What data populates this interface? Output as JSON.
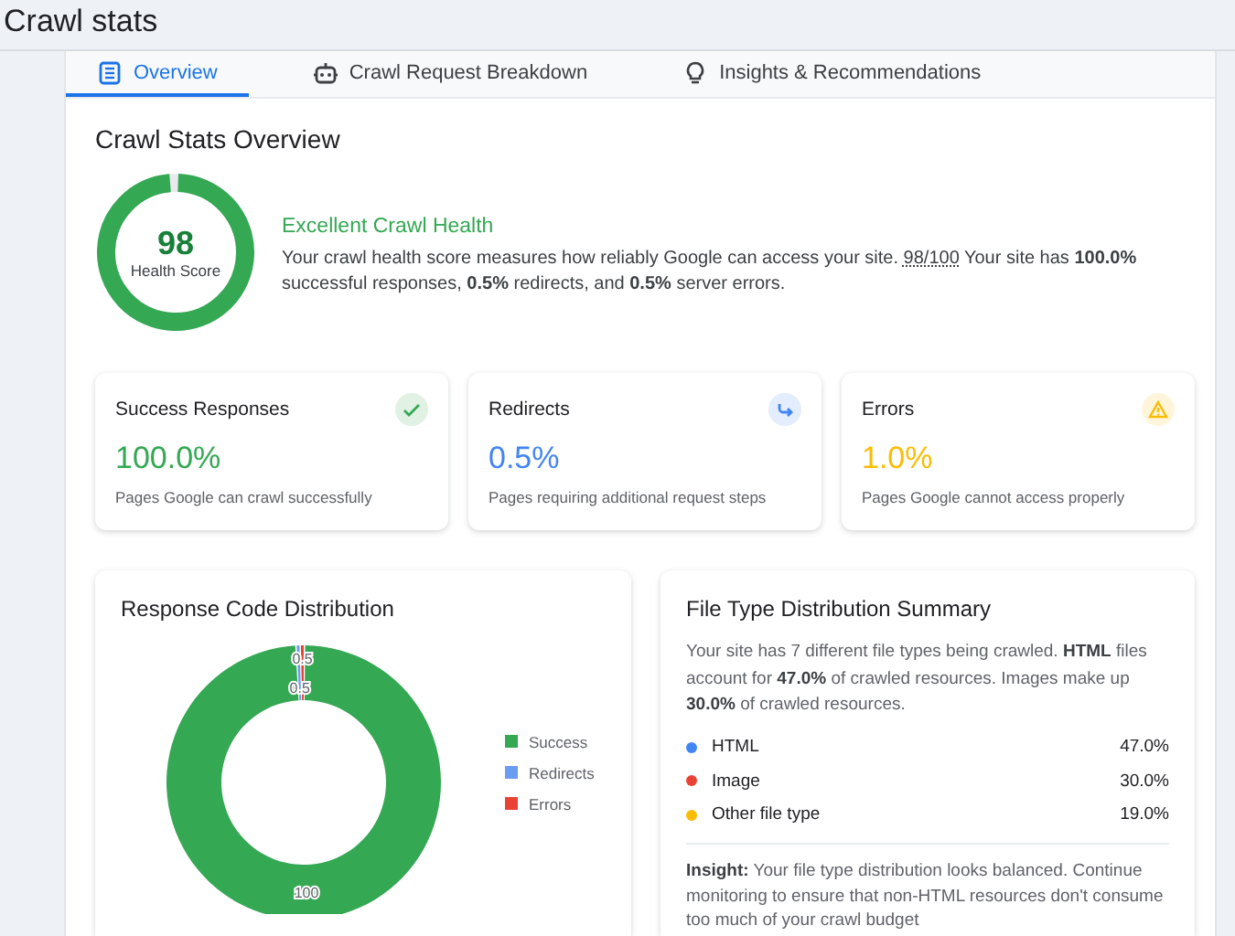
{
  "page": {
    "title": "Crawl stats"
  },
  "tabs": [
    {
      "label": "Overview",
      "selected": true
    },
    {
      "label": "Crawl Request Breakdown",
      "selected": false
    },
    {
      "label": "Insights & Recommendations",
      "selected": false
    }
  ],
  "overview": {
    "title": "Crawl Stats Overview",
    "health": {
      "score": "98",
      "label": "Health Score",
      "level": 0.98
    },
    "status": "Excellent Crawl Health",
    "description_start": "Your crawl health score measures how reliably Google can access your site.",
    "score_note": "98/100",
    "description_end": "Your site has **100.0%** successful responses, **0.5%** redirects, and **0.5%** server errors."
  },
  "metrics": [
    {
      "title": "Success Responses",
      "value": "100.0%",
      "caption": "Pages Google can crawl successfully",
      "color": "#34a853"
    },
    {
      "title": "Redirects",
      "value": "0.5%",
      "caption": "Pages requiring additional request steps",
      "color": "#4285f4"
    },
    {
      "title": "Errors",
      "value": "1.0%",
      "caption": "Pages Google cannot access properly",
      "color": "#fbbc04"
    }
  ],
  "response_chart": {
    "title": "Response Code Distribution",
    "legend": [
      {
        "color": "#34a853"
      },
      {
        "color": "#6a9cf2"
      },
      {
        "color": "#ea4335"
      }
    ],
    "chart_data": {
      "type": "donut",
      "categories": [
        "Success",
        "Redirects",
        "Errors"
      ],
      "series": [
        {
          "values": [
            100,
            0.5,
            0.5
          ]
        }
      ],
      "data_labels": true
    }
  },
  "file_types": {
    "title": "File Type Distribution Summary",
    "summary": "Your site has 7 different file types being crawled. **HTML** files account for **47.0%** of crawled resources. Images make up **30.0%** of crawled resources.",
    "items": [
      {
        "label": "HTML",
        "value": "47.0%",
        "color": "#4285f4"
      },
      {
        "label": "Image",
        "value": "30.0%",
        "color": "#ea4335"
      },
      {
        "label": "Other file type",
        "value": "19.0%",
        "color": "#fbbc04"
      }
    ],
    "insight": "**Insight:** Your file type distribution looks balanced. Continue monitoring to ensure that non-HTML resources don't consume too much of your crawl budget"
  }
}
